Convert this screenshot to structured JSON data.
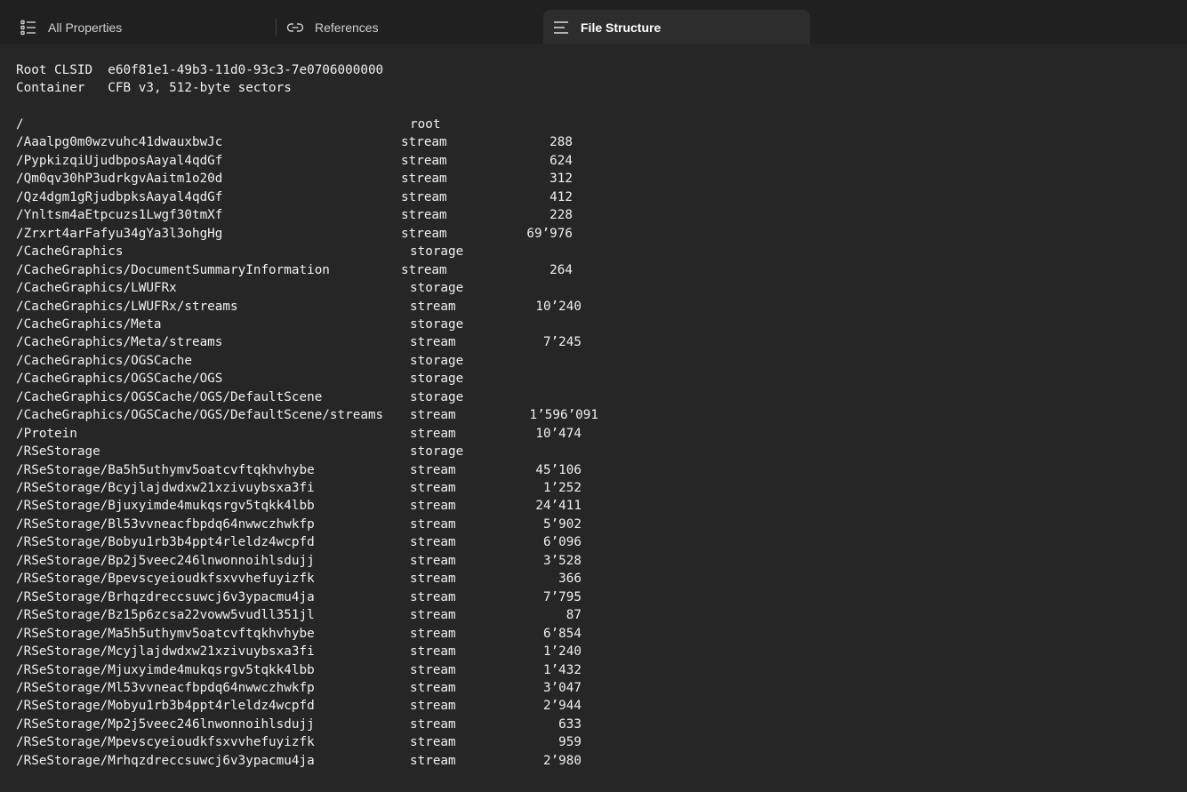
{
  "tabs": [
    {
      "label": "All Properties",
      "icon": "list-icon",
      "active": false
    },
    {
      "label": "References",
      "icon": "link-icon",
      "active": false
    },
    {
      "label": "File Structure",
      "icon": "menu-lines-icon",
      "active": true
    }
  ],
  "meta": {
    "root_clsid_label": "Root CLSID",
    "root_clsid_value": "e60f81e1-49b3-11d0-93c3-7e0706000000",
    "container_label": "Container",
    "container_value": "CFB v3, 512-byte sectors"
  },
  "entries": [
    {
      "path": "/",
      "type": "root",
      "size": ""
    },
    {
      "path": "/Aaalpg0m0wzvuhc41dwauxbwJc",
      "type": "stream",
      "size": "288"
    },
    {
      "path": "/PypkizqiUjudbposAayal4qdGf",
      "type": "stream",
      "size": "624"
    },
    {
      "path": "/Qm0qv30hP3udrkgvAaitm1o20d",
      "type": "stream",
      "size": "312"
    },
    {
      "path": "/Qz4dgm1gRjudbpksAayal4qdGf",
      "type": "stream",
      "size": "412"
    },
    {
      "path": "/Ynltsm4aEtpcuzs1Lwgf30tmXf",
      "type": "stream",
      "size": "228"
    },
    {
      "path": "/Zrxrt4arFafyu34gYa3l3ohgHg",
      "type": "stream",
      "size": "69’976"
    },
    {
      "path": "/CacheGraphics",
      "type": "storage",
      "size": ""
    },
    {
      "path": "/CacheGraphics/DocumentSummaryInformation",
      "type": "stream",
      "size": "264"
    },
    {
      "path": "/CacheGraphics/LWUFRx",
      "type": "storage",
      "size": ""
    },
    {
      "path": "/CacheGraphics/LWUFRx/streams",
      "type": "stream",
      "size": "10’240"
    },
    {
      "path": "/CacheGraphics/Meta",
      "type": "storage",
      "size": ""
    },
    {
      "path": "/CacheGraphics/Meta/streams",
      "type": "stream",
      "size": "7’245"
    },
    {
      "path": "/CacheGraphics/OGSCache",
      "type": "storage",
      "size": ""
    },
    {
      "path": "/CacheGraphics/OGSCache/OGS",
      "type": "storage",
      "size": ""
    },
    {
      "path": "/CacheGraphics/OGSCache/OGS/DefaultScene",
      "type": "storage",
      "size": ""
    },
    {
      "path": "/CacheGraphics/OGSCache/OGS/DefaultScene/streams",
      "type": "stream",
      "size": "1’596’091"
    },
    {
      "path": "/Protein",
      "type": "stream",
      "size": "10’474"
    },
    {
      "path": "/RSeStorage",
      "type": "storage",
      "size": ""
    },
    {
      "path": "/RSeStorage/Ba5h5uthymv5oatcvftqkhvhybe",
      "type": "stream",
      "size": "45’106"
    },
    {
      "path": "/RSeStorage/Bcyjlajdwdxw21xzivuybsxa3fi",
      "type": "stream",
      "size": "1’252"
    },
    {
      "path": "/RSeStorage/Bjuxyimde4mukqsrgv5tqkk4lbb",
      "type": "stream",
      "size": "24’411"
    },
    {
      "path": "/RSeStorage/Bl53vvneacfbpdq64nwwczhwkfp",
      "type": "stream",
      "size": "5’902"
    },
    {
      "path": "/RSeStorage/Bobyu1rb3b4ppt4rleldz4wcpfd",
      "type": "stream",
      "size": "6’096"
    },
    {
      "path": "/RSeStorage/Bp2j5veec246lnwonnoihlsdujj",
      "type": "stream",
      "size": "3’528"
    },
    {
      "path": "/RSeStorage/Bpevscyeioudkfsxvvhefuyizfk",
      "type": "stream",
      "size": "366"
    },
    {
      "path": "/RSeStorage/Brhqzdreccsuwcj6v3ypacmu4ja",
      "type": "stream",
      "size": "7’795"
    },
    {
      "path": "/RSeStorage/Bz15p6zcsa22voww5vudll351jl",
      "type": "stream",
      "size": "87"
    },
    {
      "path": "/RSeStorage/Ma5h5uthymv5oatcvftqkhvhybe",
      "type": "stream",
      "size": "6’854"
    },
    {
      "path": "/RSeStorage/Mcyjlajdwdxw21xzivuybsxa3fi",
      "type": "stream",
      "size": "1’240"
    },
    {
      "path": "/RSeStorage/Mjuxyimde4mukqsrgv5tqkk4lbb",
      "type": "stream",
      "size": "1’432"
    },
    {
      "path": "/RSeStorage/Ml53vvneacfbpdq64nwwczhwkfp",
      "type": "stream",
      "size": "3’047"
    },
    {
      "path": "/RSeStorage/Mobyu1rb3b4ppt4rleldz4wcpfd",
      "type": "stream",
      "size": "2’944"
    },
    {
      "path": "/RSeStorage/Mp2j5veec246lnwonnoihlsdujj",
      "type": "stream",
      "size": "633"
    },
    {
      "path": "/RSeStorage/Mpevscyeioudkfsxvvhefuyizfk",
      "type": "stream",
      "size": "959"
    },
    {
      "path": "/RSeStorage/Mrhqzdreccsuwcj6v3ypacmu4ja",
      "type": "stream",
      "size": "2’980"
    }
  ]
}
